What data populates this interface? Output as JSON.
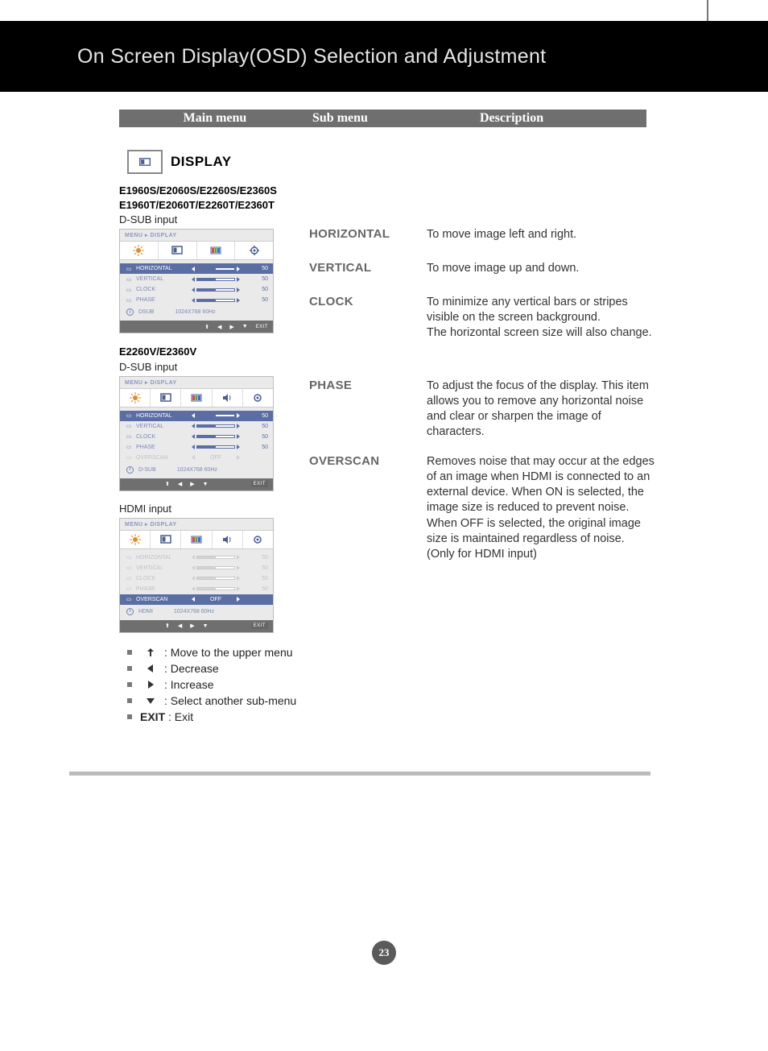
{
  "page_title": "On Screen Display(OSD) Selection and Adjustment",
  "page_number": "23",
  "header": {
    "col1": "Main menu",
    "col2": "Sub menu",
    "col3": "Description"
  },
  "display": {
    "label": "DISPLAY",
    "group1": {
      "models_line1": "E1960S/E2060S/E2260S/E2360S",
      "models_line2": "E1960T/E2060T/E2260T/E2360T",
      "input": "D-SUB input",
      "osd": {
        "breadcrumb": "MENU ▸ DISPLAY",
        "rows": [
          {
            "name": "HORIZONTAL",
            "val": "50",
            "active": true
          },
          {
            "name": "VERTICAL",
            "val": "50"
          },
          {
            "name": "CLOCK",
            "val": "50"
          },
          {
            "name": "PHASE",
            "val": "50"
          }
        ],
        "info_src": "DSUB",
        "info_res": "1024X768  60Hz",
        "exit": "EXIT"
      }
    },
    "group2": {
      "models": "E2260V/E2360V",
      "input_a": "D-SUB input",
      "osd_a": {
        "breadcrumb": "MENU ▸ DISPLAY",
        "rows": [
          {
            "name": "HORIZONTAL",
            "val": "50",
            "active": true
          },
          {
            "name": "VERTICAL",
            "val": "50"
          },
          {
            "name": "CLOCK",
            "val": "50"
          },
          {
            "name": "PHASE",
            "val": "50"
          },
          {
            "name": "OVERSCAN",
            "val": "OFF",
            "disabled": true,
            "toggle": true
          }
        ],
        "info_src": "D-SUB",
        "info_res": "1024X768  60Hz",
        "exit": "EXIT"
      },
      "input_b": "HDMI input",
      "osd_b": {
        "breadcrumb": "MENU ▸ DISPLAY",
        "rows": [
          {
            "name": "HORIZONTAL",
            "val": "50",
            "disabled": true
          },
          {
            "name": "VERTICAL",
            "val": "50",
            "disabled": true
          },
          {
            "name": "CLOCK",
            "val": "50",
            "disabled": true
          },
          {
            "name": "PHASE",
            "val": "50",
            "disabled": true
          },
          {
            "name": "OVERSCAN",
            "val": "OFF",
            "active": true,
            "toggle": true
          }
        ],
        "info_src": "HDMI",
        "info_res": "1024X768  60Hz",
        "exit": "EXIT"
      }
    }
  },
  "submenu": {
    "horizontal": "HORIZONTAL",
    "vertical": "VERTICAL",
    "clock": "CLOCK",
    "phase": "PHASE",
    "overscan": "OVERSCAN"
  },
  "descriptions": {
    "horizontal": "To move image left and right.",
    "vertical": "To move image up and down.",
    "clock": "To minimize any vertical bars or stripes visible on the screen background.\nThe horizontal screen size will also change.",
    "phase": "To adjust the focus of the display. This item allows you to remove any horizontal noise and clear or sharpen the image of characters.",
    "overscan": "Removes noise that may occur at the edges of an image when HDMI is connected to an external device.  When ON is selected, the image size is reduced to prevent noise. When OFF is selected, the original image size is maintained regardless of noise.\n(Only for HDMI input)"
  },
  "legend": {
    "up": "Move to the upper menu",
    "left": "Decrease",
    "right": "Increase",
    "down": "Select another sub-menu",
    "exit_label": "EXIT",
    "exit": "Exit"
  }
}
